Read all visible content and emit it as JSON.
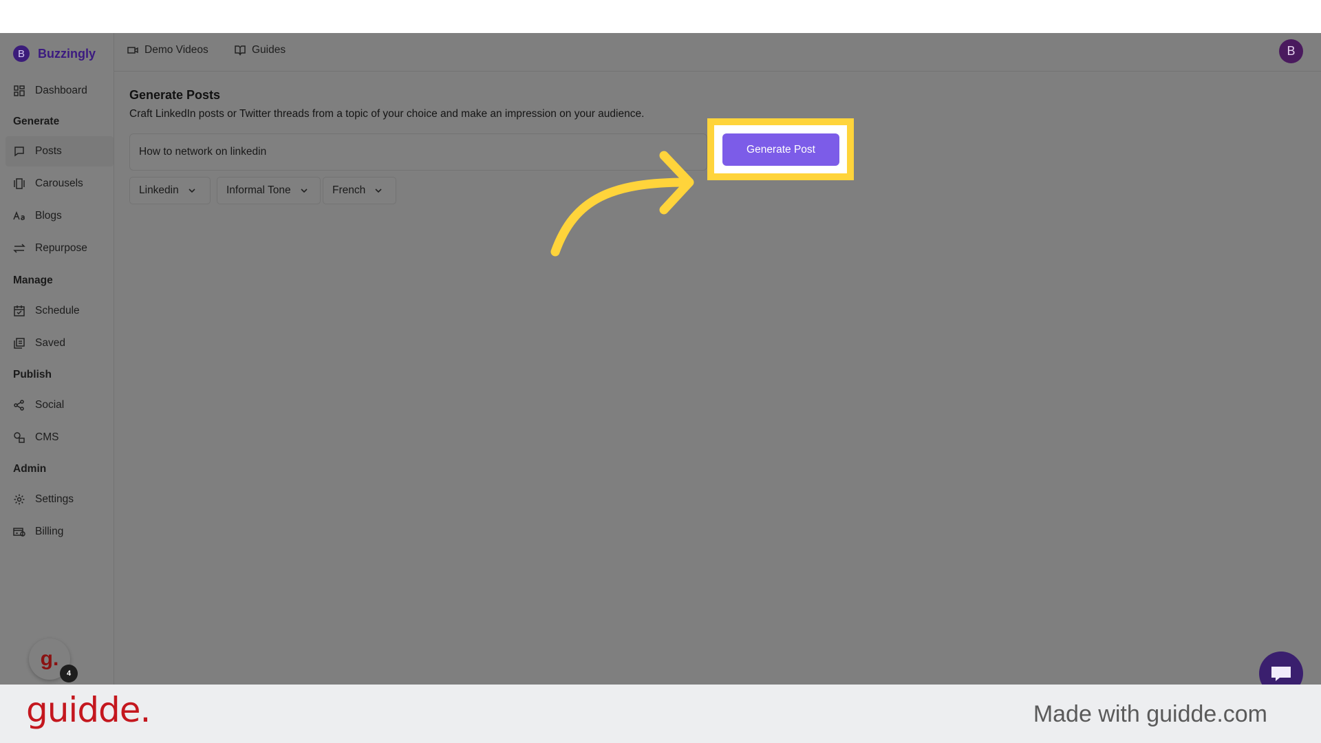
{
  "app": {
    "name": "Buzzingly",
    "logo_letter": "B"
  },
  "header": {
    "links": [
      {
        "label": "Demo Videos",
        "icon": "video-icon"
      },
      {
        "label": "Guides",
        "icon": "book-icon"
      }
    ],
    "avatar_letter": "B"
  },
  "sidebar": {
    "items": [
      {
        "label": "Dashboard",
        "icon": "grid-icon"
      },
      {
        "label": "Posts",
        "icon": "message-icon",
        "active": true
      },
      {
        "label": "Carousels",
        "icon": "carousel-icon"
      },
      {
        "label": "Blogs",
        "icon": "text-icon"
      },
      {
        "label": "Repurpose",
        "icon": "swap-arrows-icon"
      },
      {
        "label": "Schedule",
        "icon": "calendar-icon"
      },
      {
        "label": "Saved",
        "icon": "library-icon"
      },
      {
        "label": "Social",
        "icon": "share-icon"
      },
      {
        "label": "CMS",
        "icon": "shapes-icon"
      },
      {
        "label": "Settings",
        "icon": "gear-icon"
      },
      {
        "label": "Billing",
        "icon": "billing-icon"
      }
    ],
    "sections": [
      "Generate",
      "Manage",
      "Publish",
      "Admin"
    ]
  },
  "main": {
    "title": "Generate Posts",
    "description": "Craft LinkedIn posts or Twitter threads from a topic of your choice and make an impression on your audience.",
    "topic_value": "How to network on linkedin",
    "selects": [
      "Linkedin",
      "Informal Tone",
      "French"
    ],
    "generate_button": "Generate Post"
  },
  "guidde_widget": {
    "letter": "g.",
    "count": "4"
  },
  "footer": {
    "logo": "guidde.",
    "made_with": "Made with guidde.com"
  },
  "colors": {
    "accent": "#7c5ce8",
    "highlight": "#ffd43b",
    "brand": "#3b1a80",
    "overlay": "#7f7f7f",
    "footer_logo": "#c4171e"
  }
}
